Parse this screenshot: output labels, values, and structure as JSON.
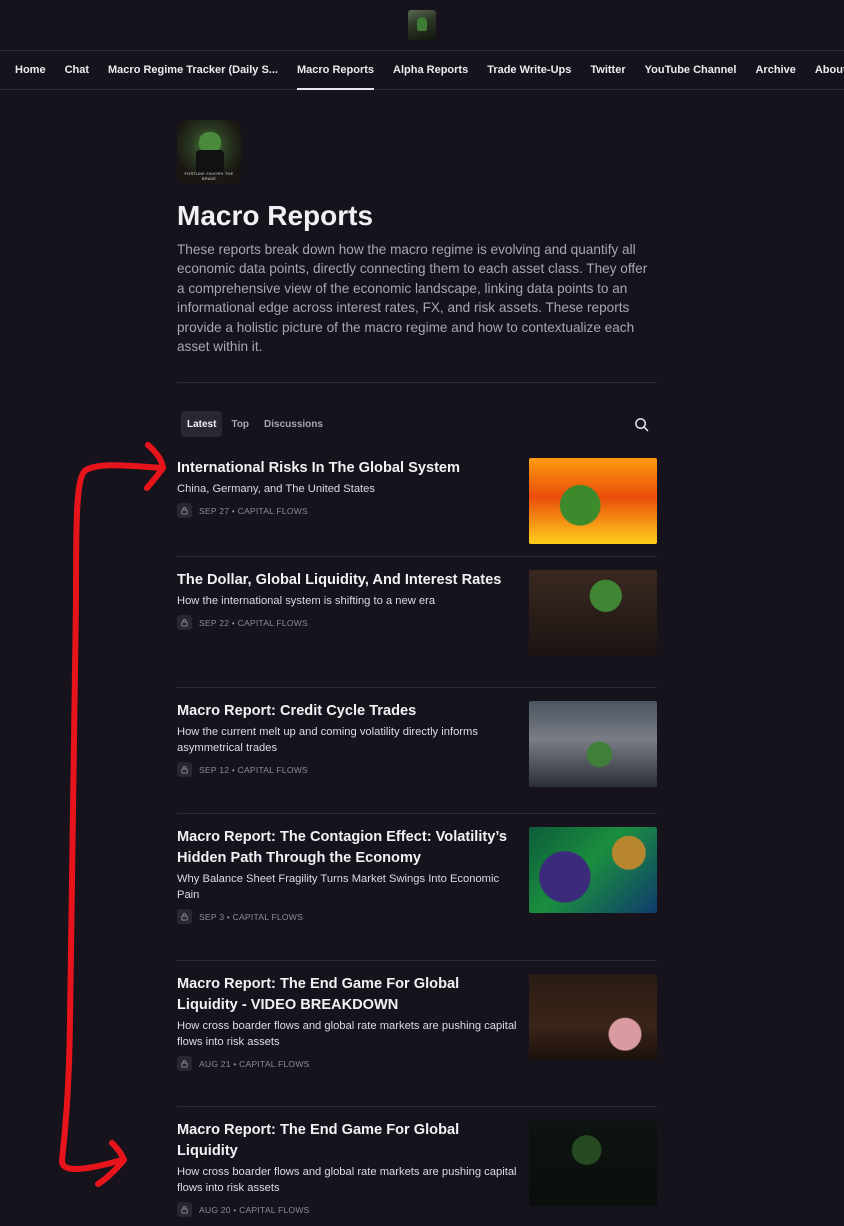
{
  "nav": {
    "items": [
      {
        "label": "Home",
        "active": false
      },
      {
        "label": "Chat",
        "active": false
      },
      {
        "label": "Macro Regime Tracker (Daily S...",
        "active": false
      },
      {
        "label": "Macro Reports",
        "active": true
      },
      {
        "label": "Alpha Reports",
        "active": false
      },
      {
        "label": "Trade Write-Ups",
        "active": false
      },
      {
        "label": "Twitter",
        "active": false
      },
      {
        "label": "YouTube Channel",
        "active": false
      },
      {
        "label": "Archive",
        "active": false
      },
      {
        "label": "About",
        "active": false
      }
    ]
  },
  "publication": {
    "avatar_caption": "FORTUNE FAVORS THE BRAVE",
    "title": "Macro Reports",
    "description": "These reports break down how the macro regime is evolving and quantify all economic data points, directly connecting them to each asset class. They offer a comprehensive view of the economic landscape, linking data points to an informational edge across interest rates, FX, and risk assets. These reports provide a holistic picture of the macro regime and how to contextualize each asset within it."
  },
  "tabs": [
    {
      "label": "Latest",
      "active": true
    },
    {
      "label": "Top",
      "active": false
    },
    {
      "label": "Discussions",
      "active": false
    }
  ],
  "posts": [
    {
      "title": "International Risks In The Global System",
      "subtitle": "China, Germany, and The United States",
      "meta": "SEP 27 • CAPITAL FLOWS",
      "thumb_icon": "pepe-fire-laptop-image"
    },
    {
      "title": "The Dollar, Global Liquidity, And Interest Rates",
      "subtitle": "How the international system is shifting to a new era",
      "meta": "SEP 22 • CAPITAL FLOWS",
      "thumb_icon": "pepe-tuxedo-image"
    },
    {
      "title": "Macro Report: Credit Cycle Trades",
      "subtitle": "How the current melt up and coming volatility directly informs asymmetrical trades",
      "meta": "SEP 12 • CAPITAL FLOWS",
      "thumb_icon": "pepe-spaceship-image"
    },
    {
      "title": "Macro Report: The Contagion Effect: Volatility’s Hidden Path Through the Economy",
      "subtitle": "Why Balance Sheet Fragility Turns Market Swings Into Economic Pain",
      "meta": "SEP 3 • CAPITAL FLOWS",
      "thumb_icon": "pepe-neon-painting-image"
    },
    {
      "title": "Macro Report: The End Game For Global Liquidity - VIDEO BREAKDOWN",
      "subtitle": "How cross boarder flows and global rate markets are pushing capital flows into risk assets",
      "meta": "AUG 21 • CAPITAL FLOWS",
      "thumb_icon": "pepe-bedroom-image"
    },
    {
      "title": "Macro Report: The End Game For Global Liquidity",
      "subtitle": "How cross boarder flows and global rate markets are pushing capital flows into risk assets",
      "meta": "AUG 20 • CAPITAL FLOWS",
      "thumb_icon": "pepe-dark-image"
    }
  ],
  "colors": {
    "background": "#16131c",
    "annotation_arrow": "#e8141c"
  }
}
